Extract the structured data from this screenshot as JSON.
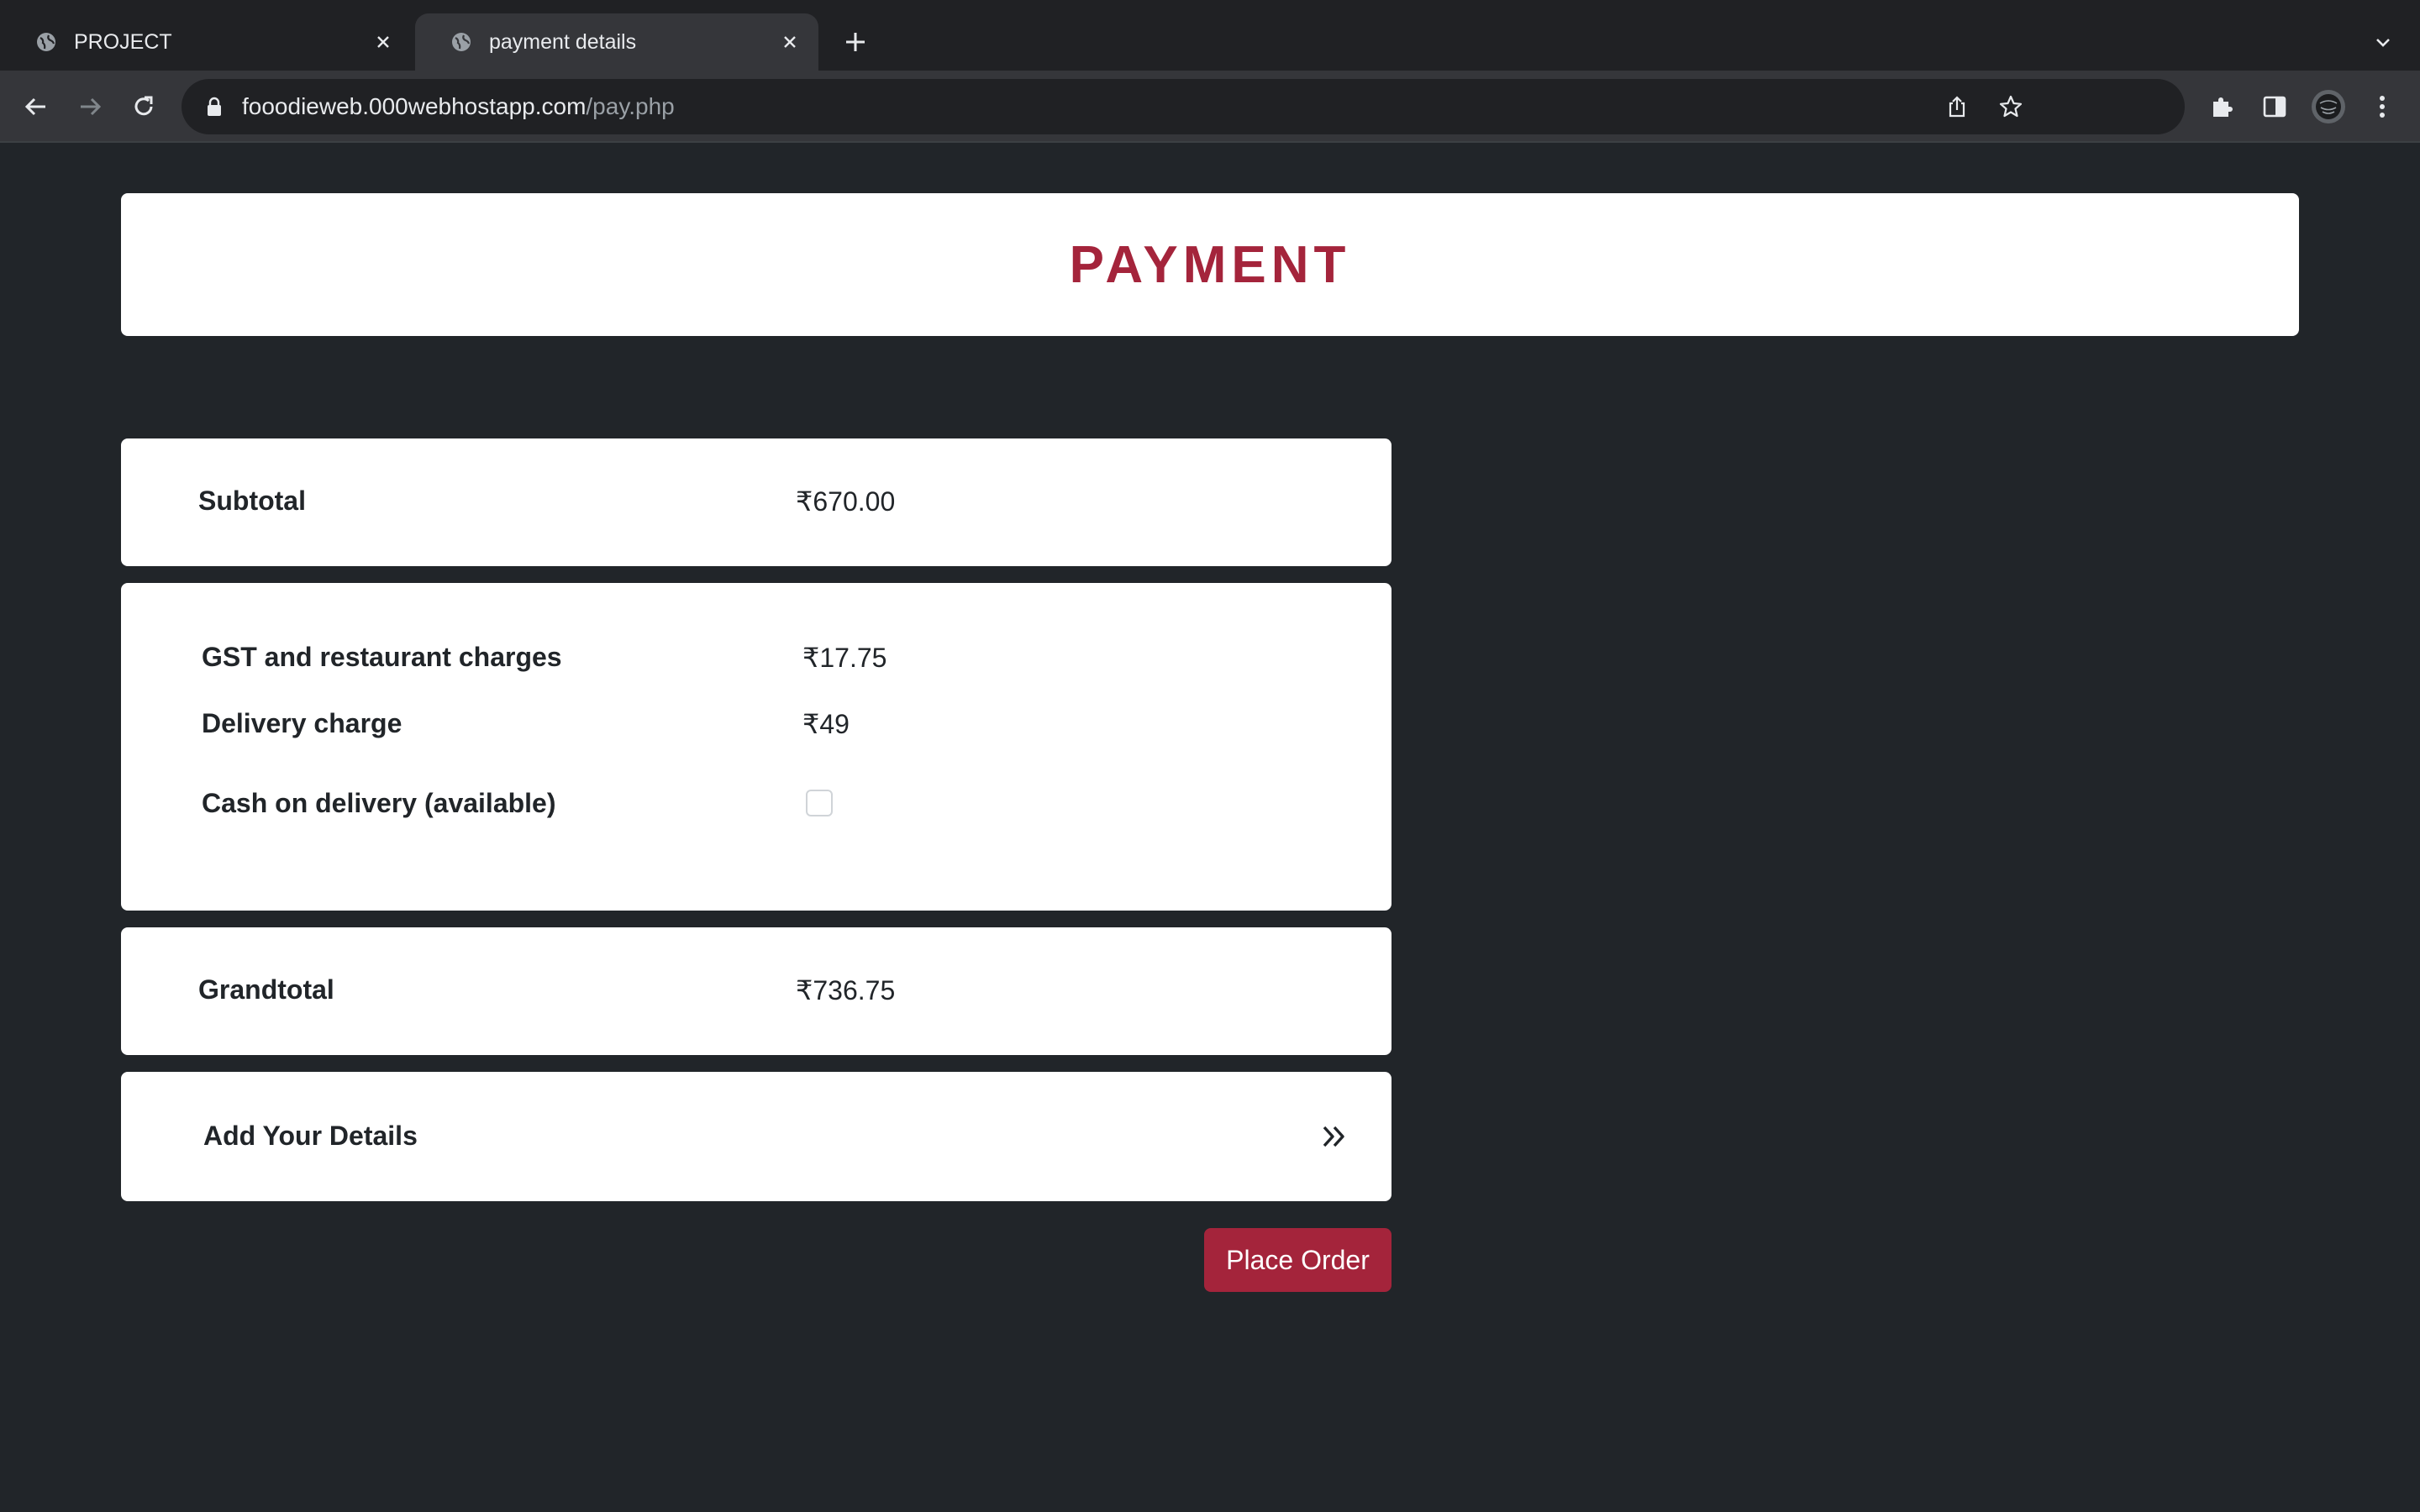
{
  "browser": {
    "tabs": [
      {
        "title": "PROJECT",
        "active": false
      },
      {
        "title": "payment details",
        "active": true
      }
    ],
    "url": {
      "domain": "fooodieweb.000webhostapp.com",
      "path": "/pay.php"
    }
  },
  "page": {
    "heading": "PAYMENT",
    "subtotal": {
      "label": "Subtotal",
      "value": "₹670.00"
    },
    "charges": {
      "gst_label": "GST and restaurant charges",
      "gst_value": "₹17.75",
      "delivery_label": "Delivery charge",
      "delivery_value": "₹49",
      "cod_label": "Cash on delivery (available)",
      "cod_checked": false
    },
    "grandtotal": {
      "label": "Grandtotal",
      "value": "₹736.75"
    },
    "details": {
      "label": "Add Your Details"
    },
    "place_order_label": "Place Order"
  },
  "colors": {
    "accent": "#a4243b",
    "page_background": "#212529",
    "card_background": "#ffffff"
  }
}
